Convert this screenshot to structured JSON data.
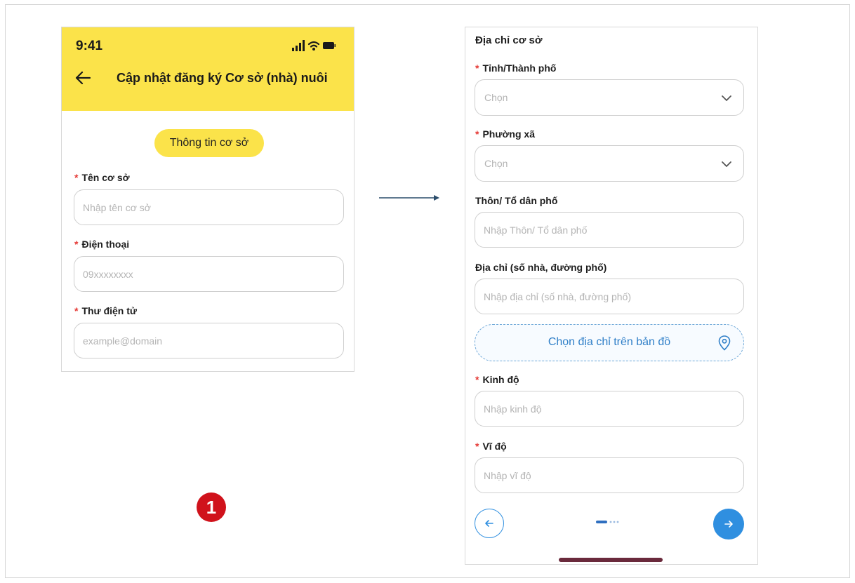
{
  "left_screen": {
    "status_time": "9:41",
    "title": "Cập nhật đăng ký Cơ sở (nhà) nuôi",
    "section_pill": "Thông tin cơ sở",
    "fields": [
      {
        "label": "Tên cơ sở",
        "required": true,
        "placeholder": "Nhập tên cơ sở"
      },
      {
        "label": "Điện thoại",
        "required": true,
        "placeholder": "09xxxxxxxx"
      },
      {
        "label": "Thư điện tử",
        "required": true,
        "placeholder": "example@domain"
      }
    ],
    "header_color": "#fbe34a"
  },
  "right_screen": {
    "section_title": "Địa chỉ cơ sở",
    "province": {
      "label": "Tỉnh/Thành phố",
      "required": true,
      "placeholder": "Chọn"
    },
    "ward": {
      "label": "Phường xã",
      "required": true,
      "placeholder": "Chọn"
    },
    "hamlet": {
      "label": "Thôn/ Tổ dân phố",
      "required": false,
      "placeholder": "Nhập Thôn/ Tổ dân phố"
    },
    "address": {
      "label": "Địa chỉ (số nhà, đường phố)",
      "required": false,
      "placeholder": "Nhập địa chỉ (số nhà, đường phố)"
    },
    "map_button": "Chọn địa chỉ trên bản đồ",
    "longitude": {
      "label": "Kinh độ",
      "required": true,
      "placeholder": "Nhập kinh độ"
    },
    "latitude": {
      "label": "Vĩ độ",
      "required": true,
      "placeholder": "Nhập vĩ độ"
    },
    "step": {
      "current": 1,
      "total": 4
    },
    "accent_color": "#2f8fe0"
  },
  "step_badge": "1",
  "required_marker": "*"
}
